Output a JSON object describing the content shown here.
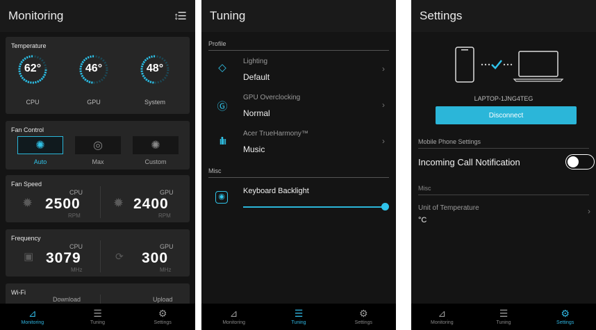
{
  "colors": {
    "accent": "#2bb6d9",
    "background": "#141414",
    "card": "#262626"
  },
  "monitoring": {
    "title": "Monitoring",
    "sort_icon": "sort-icon",
    "temperature": {
      "title": "Temperature",
      "gauges": [
        {
          "value": "62°",
          "label": "CPU"
        },
        {
          "value": "46°",
          "label": "GPU"
        },
        {
          "value": "48°",
          "label": "System"
        }
      ]
    },
    "fan_control": {
      "title": "Fan Control",
      "modes": [
        {
          "label": "Auto",
          "icon": "fan-auto-icon",
          "active": true
        },
        {
          "label": "Max",
          "icon": "fan-max-icon",
          "active": false
        },
        {
          "label": "Custom",
          "icon": "fan-custom-icon",
          "active": false
        }
      ]
    },
    "fan_speed": {
      "title": "Fan Speed",
      "cpu_label": "CPU",
      "cpu_value": "2500",
      "cpu_unit": "RPM",
      "gpu_label": "GPU",
      "gpu_value": "2400",
      "gpu_unit": "RPM"
    },
    "frequency": {
      "title": "Frequency",
      "cpu_label": "CPU",
      "cpu_value": "3079",
      "cpu_unit": "MHz",
      "gpu_label": "GPU",
      "gpu_value": "300",
      "gpu_unit": "MHz"
    },
    "wifi": {
      "title": "Wi-Fi",
      "download_label": "Download",
      "upload_label": "Upload"
    }
  },
  "tuning": {
    "title": "Tuning",
    "profile_section": "Profile",
    "rows": [
      {
        "title": "Lighting",
        "value": "Default",
        "icon": "lighting-icon"
      },
      {
        "title": "GPU Overclocking",
        "value": "Normal",
        "icon": "gpu-overclock-icon"
      },
      {
        "title": "Acer TrueHarmony™",
        "value": "Music",
        "icon": "audio-wave-icon"
      }
    ],
    "misc_section": "Misc",
    "keyboard_backlight": "Keyboard Backlight",
    "backlight_level": 1.0
  },
  "settings": {
    "title": "Settings",
    "device_name": "LAPTOP-1JNG4TEG",
    "disconnect_label": "Disconnect",
    "mobile_section": "Mobile Phone Settings",
    "incoming_call_label": "Incoming Call Notification",
    "incoming_call_enabled": false,
    "misc_section": "Misc",
    "unit_title": "Unit of Temperature",
    "unit_value": "°C"
  },
  "nav": {
    "monitoring": "Monitoring",
    "tuning": "Tuning",
    "settings": "Settings"
  }
}
